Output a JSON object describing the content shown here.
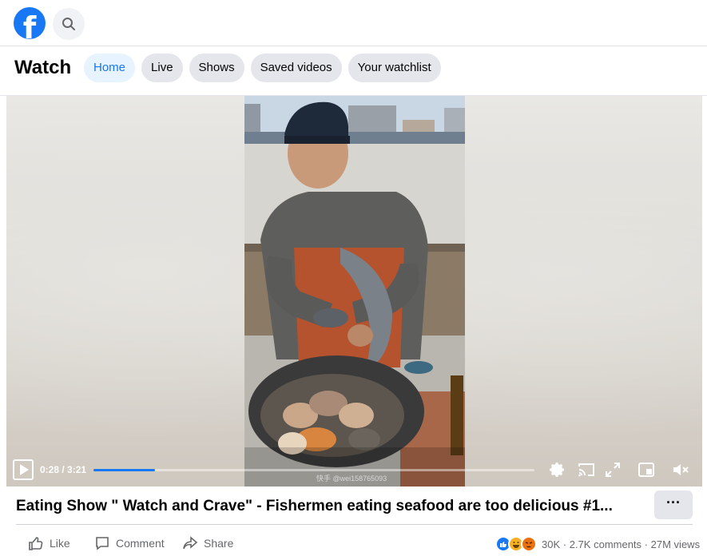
{
  "topbar": {
    "logo_letter": "f",
    "search_icon": "search-icon"
  },
  "watch_header": {
    "title": "Watch",
    "tabs": [
      {
        "label": "Home",
        "active": true
      },
      {
        "label": "Live",
        "active": false
      },
      {
        "label": "Shows",
        "active": false
      },
      {
        "label": "Saved videos",
        "active": false
      },
      {
        "label": "Your watchlist",
        "active": false
      }
    ]
  },
  "video": {
    "current_time": "0:28",
    "duration": "3:21",
    "time_display": "0:28 / 3:21",
    "progress_fraction": 0.139,
    "watermark": "快手 @wei158765093",
    "icons": [
      "play-icon",
      "settings-gear-icon",
      "cast-icon",
      "fullscreen-icon",
      "picture-in-picture-icon",
      "mute-icon"
    ]
  },
  "post": {
    "title": "Eating Show \" Watch and Crave\" - Fishermen eating seafood are too delicious #1...",
    "more_label": "···",
    "actions": {
      "like": "Like",
      "comment": "Comment",
      "share": "Share"
    },
    "reactions_count": "30K",
    "comments": "2.7K comments",
    "views": "27M views",
    "separator": "·"
  },
  "colors": {
    "brand": "#1877f2",
    "tab_active_bg": "#e7f3ff",
    "secondary_text": "#65676b"
  }
}
